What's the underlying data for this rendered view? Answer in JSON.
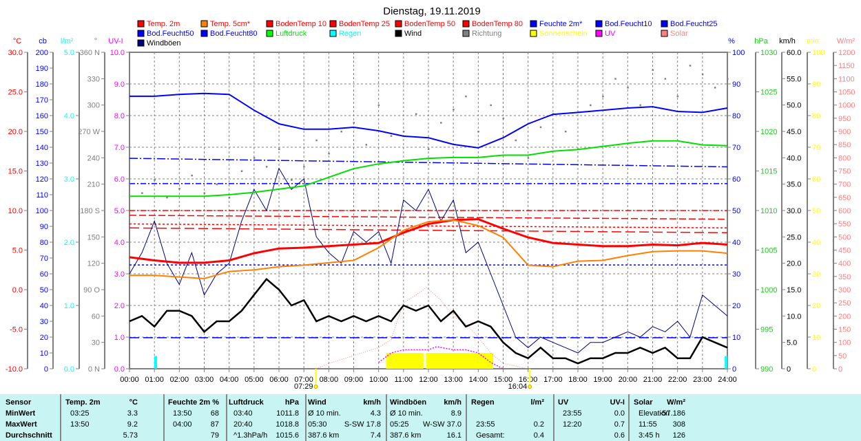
{
  "chart_data": {
    "type": "line",
    "title": "Dienstag, 19.11.2019",
    "xlabel": "",
    "x_ticks": [
      "00:00",
      "01:00",
      "02:00",
      "03:00",
      "04:00",
      "05:00",
      "06:00",
      "07:00",
      "08:00",
      "09:00",
      "10:00",
      "11:00",
      "12:00",
      "13:00",
      "14:00",
      "15:00",
      "16:00",
      "17:00",
      "18:00",
      "19:00",
      "20:00",
      "21:00",
      "22:00",
      "23:00",
      "24:00"
    ],
    "xlim": [
      0,
      24
    ],
    "grid": true,
    "legend_position": "top",
    "sunrise": "07:29",
    "sunrise_h": 7.48,
    "sunset": "16:04",
    "sunset_h": 16.07,
    "axes_left": [
      {
        "id": "temp",
        "unit": "°C",
        "color": "#ff0000",
        "min": -10,
        "max": 30,
        "ticks": [
          -10,
          -5,
          0,
          5,
          10,
          15,
          20,
          25,
          30
        ],
        "labels": [
          "-10.0",
          "-5.0",
          "0.0",
          "5.0",
          "10.0",
          "15.0",
          "20.0",
          "25.0",
          "30.0"
        ]
      },
      {
        "id": "cb",
        "unit": "cb",
        "color": "#0000ff",
        "min": 0,
        "max": 200,
        "ticks": [
          0,
          10,
          20,
          30,
          40,
          50,
          60,
          70,
          80,
          90,
          100,
          110,
          120,
          130,
          140,
          150,
          160,
          170,
          180,
          190,
          200
        ],
        "labels": [
          "0",
          "10",
          "20",
          "30",
          "40",
          "50",
          "60",
          "70",
          "80",
          "90",
          "100",
          "110",
          "120",
          "130",
          "140",
          "150",
          "160",
          "170",
          "180",
          "190",
          "200"
        ]
      },
      {
        "id": "rain",
        "unit": "l/m²",
        "color": "#00ffff",
        "min": 0,
        "max": 5,
        "ticks": [
          0,
          1,
          2,
          3,
          4,
          5
        ],
        "labels": [
          "0.0",
          "1.0",
          "2.0",
          "3.0",
          "4.0",
          "5.0"
        ]
      },
      {
        "id": "dir",
        "unit": "°",
        "color": "#808080",
        "min": 0,
        "max": 360,
        "ticks": [
          0,
          30,
          60,
          90,
          120,
          150,
          180,
          210,
          240,
          270,
          300,
          330,
          360
        ],
        "labels": [
          "0 N",
          "30",
          "60",
          "90 O",
          "120",
          "150",
          "180 S",
          "210",
          "240",
          "270 W",
          "300",
          "330",
          "360 N"
        ]
      },
      {
        "id": "uvi",
        "unit": "UV-I",
        "color": "#ff00ff",
        "min": 0,
        "max": 10,
        "ticks": [
          0,
          1,
          2,
          3,
          4,
          5,
          6,
          7,
          8,
          9,
          10
        ],
        "labels": [
          "0.0",
          "1.0",
          "2.0",
          "3.0",
          "4.0",
          "5.0",
          "6.0",
          "7.0",
          "8.0",
          "9.0",
          "10.0"
        ]
      }
    ],
    "axes_right": [
      {
        "id": "hum",
        "unit": "%",
        "color": "#0000ff",
        "min": 0,
        "max": 100,
        "ticks": [
          0,
          10,
          20,
          30,
          40,
          50,
          60,
          70,
          80,
          90,
          100
        ],
        "labels": [
          "0",
          "10",
          "20",
          "30",
          "40",
          "50",
          "60",
          "70",
          "80",
          "90",
          "100"
        ]
      },
      {
        "id": "press",
        "unit": "hPa",
        "color": "#00e000",
        "min": 990,
        "max": 1030,
        "ticks": [
          990,
          995,
          1000,
          1005,
          1010,
          1015,
          1020,
          1025,
          1030
        ],
        "labels": [
          "990",
          "995",
          "1000",
          "1005",
          "1010",
          "1015",
          "1020",
          "1025",
          "1030"
        ]
      },
      {
        "id": "wind",
        "unit": "km/h",
        "color": "#000000",
        "min": 0,
        "max": 60,
        "ticks": [
          0,
          5,
          10,
          15,
          20,
          25,
          30,
          35,
          40,
          45,
          50,
          55,
          60
        ],
        "labels": [
          "0",
          "5.0",
          "10.0",
          "15.0",
          "20.0",
          "25.0",
          "30.0",
          "35.0",
          "40.0",
          "45.0",
          "50.0",
          "55.0",
          "60.0"
        ]
      },
      {
        "id": "sun",
        "unit": "min",
        "color": "#ffff00",
        "min": 0,
        "max": 100,
        "ticks": [
          0,
          10,
          20,
          30,
          40,
          50,
          60,
          70,
          80,
          90,
          100
        ],
        "labels": [
          "0",
          "10",
          "20",
          "30",
          "40",
          "50",
          "60",
          "70",
          "80",
          "90",
          "100"
        ]
      },
      {
        "id": "solar",
        "unit": "W/m²",
        "color": "#ff8080",
        "min": 0,
        "max": 1200,
        "ticks": [
          0,
          50,
          100,
          150,
          200,
          250,
          300,
          350,
          400,
          450,
          500,
          550,
          600,
          650,
          700,
          750,
          800,
          850,
          900,
          950,
          1000,
          1050,
          1100,
          1150,
          1200
        ],
        "labels": [
          "0",
          "50",
          "100",
          "150",
          "200",
          "250",
          "300",
          "350",
          "400",
          "450",
          "500",
          "550",
          "600",
          "650",
          "700",
          "750",
          "800",
          "850",
          "900",
          "950",
          "1000",
          "1050",
          "1100",
          "1150",
          "1200"
        ]
      }
    ],
    "legend": [
      [
        "Temp. 2m",
        "#ff0000",
        "#ff0000"
      ],
      [
        "Temp. 5cm*",
        "#ff8000",
        "#ff0000"
      ],
      [
        "BodenTemp 10",
        "#ff0000",
        "#ff0000"
      ],
      [
        "BodenTemp 25",
        "#ff0000",
        "#ff0000"
      ],
      [
        "BodenTemp 50",
        "#ff0000",
        "#ff0000"
      ],
      [
        "BodenTemp 80",
        "#ff0000",
        "#ff0000"
      ],
      [
        "Feuchte 2m*",
        "#0000ff",
        "#0000ff"
      ],
      [
        "Bod.Feucht10",
        "#0000ff",
        "#0000ff"
      ],
      [
        "Bod.Feucht25",
        "#0000ff",
        "#0000ff"
      ],
      [
        "Bod.Feucht50",
        "#0000ff",
        "#0000ff"
      ],
      [
        "Bod.Feucht80",
        "#0000ff",
        "#0000ff"
      ],
      [
        "Luftdruck",
        "#00ff00",
        "#00e000"
      ],
      [
        "Regen",
        "#00ffff",
        "#00ffff"
      ],
      [
        "Wind",
        "#000000",
        "#000000"
      ],
      [
        "Richtung",
        "#808080",
        "#808080"
      ],
      [
        "Sonnenschein",
        "#ffff00",
        "#ffff00"
      ],
      [
        "UV",
        "#ff00ff",
        "#ff00ff"
      ],
      [
        "Solar",
        "#ff8080",
        "#ff8080"
      ],
      [
        "Windböen",
        "#000080",
        "#000000"
      ]
    ],
    "hours": [
      0,
      1,
      2,
      3,
      4,
      5,
      6,
      7,
      8,
      9,
      10,
      11,
      12,
      13,
      14,
      15,
      16,
      17,
      18,
      19,
      20,
      21,
      22,
      23,
      24
    ],
    "series": [
      {
        "name": "Temp. 2m",
        "axis": "temp",
        "color": "#ff0000",
        "width": 3,
        "values": [
          4.1,
          3.7,
          3.4,
          3.4,
          3.7,
          4.6,
          5.2,
          5.3,
          5.5,
          5.7,
          5.9,
          7.2,
          8.3,
          8.8,
          8.9,
          7.7,
          6.6,
          5.9,
          5.7,
          5.5,
          5.5,
          5.7,
          5.6,
          5.9,
          5.7
        ]
      },
      {
        "name": "Temp. 5cm*",
        "axis": "temp",
        "color": "#ff8000",
        "width": 2,
        "values": [
          1.8,
          1.8,
          1.6,
          1.4,
          2.3,
          2.5,
          2.9,
          3.1,
          3.4,
          3.7,
          5.3,
          7.5,
          8.6,
          8.8,
          8.1,
          6.6,
          3.1,
          2.9,
          3.6,
          3.7,
          4.3,
          4.8,
          4.9,
          4.9,
          4.6
        ]
      },
      {
        "name": "Feuchte 2m*",
        "axis": "hum",
        "color": "#0000ff",
        "width": 2,
        "values": [
          86.1,
          86.1,
          86.7,
          87,
          86.7,
          81.7,
          77.4,
          75.7,
          75.7,
          76.3,
          75.2,
          73.5,
          73,
          70.9,
          69.8,
          73,
          77.4,
          80.4,
          81,
          81.7,
          82.4,
          82.8,
          81.3,
          81,
          82.4
        ]
      },
      {
        "name": "Luftdruck",
        "axis": "press",
        "color": "#00e000",
        "width": 2,
        "values": [
          1011.8,
          1011.8,
          1011.8,
          1011.8,
          1012.0,
          1012.3,
          1012.7,
          1013.1,
          1014.2,
          1015.3,
          1015.9,
          1016.3,
          1016.6,
          1016.7,
          1016.7,
          1017.0,
          1017.0,
          1017.5,
          1017.7,
          1018.1,
          1018.5,
          1018.8,
          1018.8,
          1018.3,
          1018.2
        ]
      }
    ],
    "half_hours": [
      0,
      0.5,
      1,
      1.5,
      2,
      2.5,
      3,
      3.5,
      4,
      4.5,
      5,
      5.5,
      6,
      6.5,
      7,
      7.5,
      8,
      8.5,
      9,
      9.5,
      10,
      10.5,
      11,
      11.5,
      12,
      12.5,
      13,
      13.5,
      14,
      14.5,
      15,
      15.5,
      16,
      16.5,
      17,
      17.5,
      18,
      18.5,
      19,
      19.5,
      20,
      20.5,
      21,
      21.5,
      22,
      22.5,
      23,
      23.5,
      24
    ],
    "wind": {
      "name": "Wind",
      "axis": "wind",
      "color": "#000000",
      "values": [
        9,
        10,
        8,
        11,
        11,
        10,
        7,
        9,
        9,
        11,
        14,
        17,
        15,
        12,
        13,
        9,
        10,
        9,
        10,
        9,
        10,
        9,
        12,
        11,
        12,
        9,
        11,
        8,
        9,
        8,
        5,
        3,
        2,
        4,
        2,
        2,
        1,
        2,
        2,
        3,
        3,
        4,
        3,
        4,
        2,
        2,
        6,
        5,
        4
      ]
    },
    "gusts": {
      "name": "Windböen",
      "axis": "wind",
      "color": "#000080",
      "values": [
        18,
        22,
        28,
        20,
        16,
        22,
        14,
        18,
        20,
        28,
        34,
        30,
        38,
        34,
        36,
        25,
        22,
        20,
        26,
        24,
        26,
        20,
        32,
        30,
        34,
        28,
        32,
        22,
        24,
        18,
        12,
        6,
        4,
        6,
        5,
        4,
        3,
        5,
        5,
        6,
        7,
        6,
        8,
        7,
        9,
        6,
        14,
        12,
        10
      ]
    },
    "direction": {
      "name": "Richtung",
      "axis": "dir",
      "color": "#808080",
      "values": [
        210,
        200,
        215,
        195,
        205,
        220,
        200,
        210,
        195,
        225,
        240,
        230,
        250,
        215,
        230,
        260,
        245,
        270,
        280,
        255,
        300,
        265,
        270,
        290,
        250,
        280,
        295,
        310,
        270,
        300,
        285,
        260,
        240,
        275,
        290,
        270,
        250,
        300,
        310,
        330,
        320,
        300,
        340,
        330,
        310,
        345,
        335,
        320,
        330
      ]
    },
    "soil": [
      {
        "name": "BodenTemp 10",
        "axis": "temp",
        "color": "#ff0000",
        "dash": "8,3,2,3",
        "values": [
          10.0,
          10.0
        ]
      },
      {
        "name": "BodenTemp 25",
        "axis": "temp",
        "color": "#ff0000",
        "dash": "10,4",
        "values": [
          9.4,
          8.9
        ]
      },
      {
        "name": "BodenTemp 50",
        "axis": "temp",
        "color": "#ff0000",
        "dash": "3,3",
        "values": [
          8.3,
          7.8
        ]
      },
      {
        "name": "BodenTemp 80",
        "axis": "temp",
        "color": "#ff0000",
        "dash": "14,6",
        "values": [
          7.8,
          7.2
        ]
      },
      {
        "name": "Bod.Feucht10",
        "axis": "hum",
        "color": "#0000ff",
        "dash": "12,3,2,3",
        "values": [
          66.5,
          63.8
        ]
      },
      {
        "name": "Bod.Feucht25",
        "axis": "hum",
        "color": "#0000ff",
        "dash": "8,3,2,3",
        "values": [
          58.5,
          58.5
        ]
      },
      {
        "name": "Bod.Feucht50",
        "axis": "hum",
        "color": "#0000ff",
        "dash": "3,3",
        "values": [
          32.8,
          32.8
        ]
      },
      {
        "name": "Bod.Feucht80",
        "axis": "hum",
        "color": "#0000ff",
        "dash": "14,6",
        "values": [
          9.8,
          9.8
        ]
      }
    ],
    "rain": {
      "name": "Regen",
      "axis": "rain",
      "color": "#00ffff",
      "bars": [
        [
          1.05,
          0.2
        ],
        [
          23.95,
          0.2
        ]
      ]
    },
    "sunshine": {
      "name": "Sonnenschein",
      "axis": "sun",
      "color": "#ffff00",
      "intervals": [
        [
          10.3,
          11.8,
          5
        ],
        [
          11.9,
          14.6,
          5
        ]
      ]
    },
    "uv": {
      "name": "UV",
      "axis": "uvi",
      "color": "#ff00ff",
      "x": [
        10,
        10.5,
        11,
        11.5,
        12,
        12.33,
        13,
        13.5,
        14,
        14.5,
        15
      ],
      "values": [
        0.2,
        0.5,
        0.6,
        0.6,
        0.6,
        0.7,
        0.6,
        0.6,
        0.5,
        0.2,
        0.0
      ]
    },
    "solar": {
      "name": "Solar",
      "axis": "solar",
      "color": "#ff8080",
      "x": [
        7.5,
        8,
        9,
        10,
        10.5,
        11,
        11.5,
        11.92,
        12.5,
        13,
        13.5,
        14,
        14.5,
        15,
        16
      ],
      "values": [
        0,
        20,
        50,
        80,
        110,
        250,
        280,
        308,
        260,
        200,
        170,
        120,
        60,
        20,
        0
      ]
    }
  },
  "table": {
    "columns": [
      {
        "header": [
          "Sensor",
          ""
        ],
        "rows": [
          [
            "MinWert",
            ""
          ],
          [
            "MaxWert",
            ""
          ],
          [
            "Durchschnitt",
            ""
          ]
        ],
        "bold": true
      },
      {
        "header": [
          "Temp. 2m",
          "°C"
        ],
        "rows": [
          [
            "03:25",
            "3.3"
          ],
          [
            "13:50",
            "9.2"
          ],
          [
            "",
            "5.73"
          ]
        ]
      },
      {
        "header": [
          "Feuchte 2m",
          "%"
        ],
        "rows": [
          [
            "13:50",
            "68"
          ],
          [
            "04:00",
            "87"
          ],
          [
            "",
            "79"
          ]
        ]
      },
      {
        "header": [
          "Luftdruck",
          "hPa"
        ],
        "rows": [
          [
            "03:40",
            "1011.8"
          ],
          [
            "20:40",
            "1018.8"
          ],
          [
            "^1.3hPa/h",
            "1015.6"
          ]
        ]
      },
      {
        "header": [
          "Wind",
          "km/h"
        ],
        "rows": [
          [
            "Ø 10 min.",
            "4.3"
          ],
          [
            "05:30",
            "S-SW 17.8"
          ],
          [
            "387.6 km",
            "7.4"
          ]
        ]
      },
      {
        "header": [
          "Windböen",
          "km/h"
        ],
        "rows": [
          [
            "Ø 10 min.",
            "8.9"
          ],
          [
            "05:25",
            "W-SW 37.0"
          ],
          [
            "387.6 km",
            "16.1"
          ]
        ]
      },
      {
        "header": [
          "Regen",
          "l/m²"
        ],
        "rows": [
          [
            "",
            ""
          ],
          [
            "23:55",
            "0.2"
          ],
          [
            "Gesamt:",
            "0.4"
          ]
        ]
      },
      {
        "header": [
          "UV",
          "UV-I"
        ],
        "rows": [
          [
            "23:55",
            "0.0"
          ],
          [
            "12:20",
            "0.7"
          ],
          [
            "",
            "0.6"
          ]
        ]
      },
      {
        "header": [
          "Solar",
          "W/m²"
        ],
        "rows": [
          [
            "Elevation",
            "-57.186"
          ],
          [
            "11:55",
            "308"
          ],
          [
            "3:45 h",
            "126"
          ]
        ]
      }
    ]
  }
}
